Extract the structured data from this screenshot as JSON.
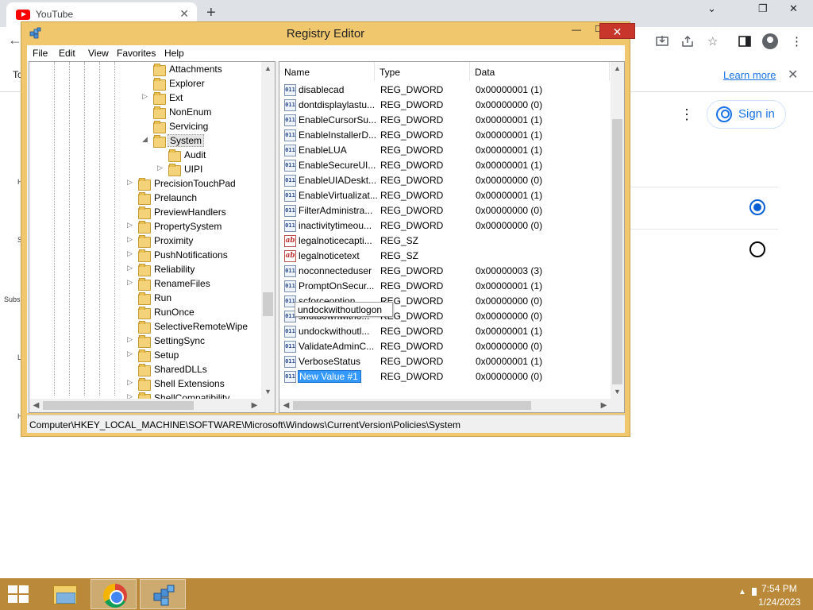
{
  "browser": {
    "tab_title": "YouTube",
    "tab_close": "✕",
    "new_tab": "+",
    "back": "←",
    "minimize": "⌄",
    "restore": "❐",
    "close": "✕",
    "infobar_left": "To",
    "learn_more": "Learn more",
    "infobar_close": "✕",
    "kebab": "⋮",
    "sign_in": "Sign in",
    "left_letters": [
      "H",
      "S",
      "Subs",
      "L",
      "H"
    ]
  },
  "regedit": {
    "title": "Registry Editor",
    "minimize": "—",
    "maximize": "☐",
    "close": "✕",
    "menu": [
      "File",
      "Edit",
      "View",
      "Favorites",
      "Help"
    ],
    "tree": [
      {
        "label": "Attachments",
        "expander": ""
      },
      {
        "label": "Explorer",
        "expander": ""
      },
      {
        "label": "Ext",
        "expander": "▷"
      },
      {
        "label": "NonEnum",
        "expander": ""
      },
      {
        "label": "Servicing",
        "expander": ""
      },
      {
        "label": "System",
        "expander": "◢",
        "selected": true
      },
      {
        "label": "Audit",
        "expander": ""
      },
      {
        "label": "UIPI",
        "expander": "▷"
      },
      {
        "label": "PrecisionTouchPad",
        "expander": "▷"
      },
      {
        "label": "Prelaunch",
        "expander": ""
      },
      {
        "label": "PreviewHandlers",
        "expander": ""
      },
      {
        "label": "PropertySystem",
        "expander": "▷"
      },
      {
        "label": "Proximity",
        "expander": "▷"
      },
      {
        "label": "PushNotifications",
        "expander": "▷"
      },
      {
        "label": "Reliability",
        "expander": "▷"
      },
      {
        "label": "RenameFiles",
        "expander": "▷"
      },
      {
        "label": "Run",
        "expander": ""
      },
      {
        "label": "RunOnce",
        "expander": ""
      },
      {
        "label": "SelectiveRemoteWipe",
        "expander": ""
      },
      {
        "label": "SettingSync",
        "expander": "▷"
      },
      {
        "label": "Setup",
        "expander": "▷"
      },
      {
        "label": "SharedDLLs",
        "expander": ""
      },
      {
        "label": "Shell Extensions",
        "expander": "▷"
      },
      {
        "label": "ShellCompatibility",
        "expander": "▷"
      }
    ],
    "columns": {
      "name": "Name",
      "type": "Type",
      "data": "Data"
    },
    "values": [
      {
        "name": "disablecad",
        "type": "REG_DWORD",
        "data": "0x00000001 (1)",
        "icon": "dword"
      },
      {
        "name": "dontdisplaylastu...",
        "type": "REG_DWORD",
        "data": "0x00000000 (0)",
        "icon": "dword"
      },
      {
        "name": "EnableCursorSu...",
        "type": "REG_DWORD",
        "data": "0x00000001 (1)",
        "icon": "dword"
      },
      {
        "name": "EnableInstallerD...",
        "type": "REG_DWORD",
        "data": "0x00000001 (1)",
        "icon": "dword"
      },
      {
        "name": "EnableLUA",
        "type": "REG_DWORD",
        "data": "0x00000001 (1)",
        "icon": "dword"
      },
      {
        "name": "EnableSecureUI...",
        "type": "REG_DWORD",
        "data": "0x00000001 (1)",
        "icon": "dword"
      },
      {
        "name": "EnableUIADeskt...",
        "type": "REG_DWORD",
        "data": "0x00000000 (0)",
        "icon": "dword"
      },
      {
        "name": "EnableVirtualizat...",
        "type": "REG_DWORD",
        "data": "0x00000001 (1)",
        "icon": "dword"
      },
      {
        "name": "FilterAdministra...",
        "type": "REG_DWORD",
        "data": "0x00000000 (0)",
        "icon": "dword"
      },
      {
        "name": "inactivitytimeou...",
        "type": "REG_DWORD",
        "data": "0x00000000 (0)",
        "icon": "dword"
      },
      {
        "name": "legalnoticecapti...",
        "type": "REG_SZ",
        "data": "",
        "icon": "sz"
      },
      {
        "name": "legalnoticetext",
        "type": "REG_SZ",
        "data": "",
        "icon": "sz"
      },
      {
        "name": "noconnecteduser",
        "type": "REG_DWORD",
        "data": "0x00000003 (3)",
        "icon": "dword"
      },
      {
        "name": "PromptOnSecur...",
        "type": "REG_DWORD",
        "data": "0x00000001 (1)",
        "icon": "dword"
      },
      {
        "name": "scforceoption",
        "type": "REG_DWORD",
        "data": "0x00000000 (0)",
        "icon": "dword"
      },
      {
        "name": "shutdownwitho...",
        "type": "REG_DWORD",
        "data": "0x00000000 (0)",
        "icon": "dword"
      },
      {
        "name": "undockwithoutl...",
        "type": "REG_DWORD",
        "data": "0x00000001 (1)",
        "icon": "dword"
      },
      {
        "name": "ValidateAdminC...",
        "type": "REG_DWORD",
        "data": "0x00000000 (0)",
        "icon": "dword"
      },
      {
        "name": "VerboseStatus",
        "type": "REG_DWORD",
        "data": "0x00000001 (1)",
        "icon": "dword"
      },
      {
        "name": "New Value #1",
        "type": "REG_DWORD",
        "data": "0x00000000 (0)",
        "icon": "dword",
        "editing": true
      }
    ],
    "tooltip": "undockwithoutlogon",
    "status_path": "Computer\\HKEY_LOCAL_MACHINE\\SOFTWARE\\Microsoft\\Windows\\CurrentVersion\\Policies\\System"
  },
  "taskbar": {
    "time": "7:54 PM",
    "date": "1/24/2023",
    "tray_arrow": "▲"
  },
  "colors": {
    "window_frame": "#f0c76c",
    "taskbar": "#ba8a3a",
    "close_button": "#c7352b",
    "selection": "#3399ff",
    "link": "#1a73e8"
  }
}
